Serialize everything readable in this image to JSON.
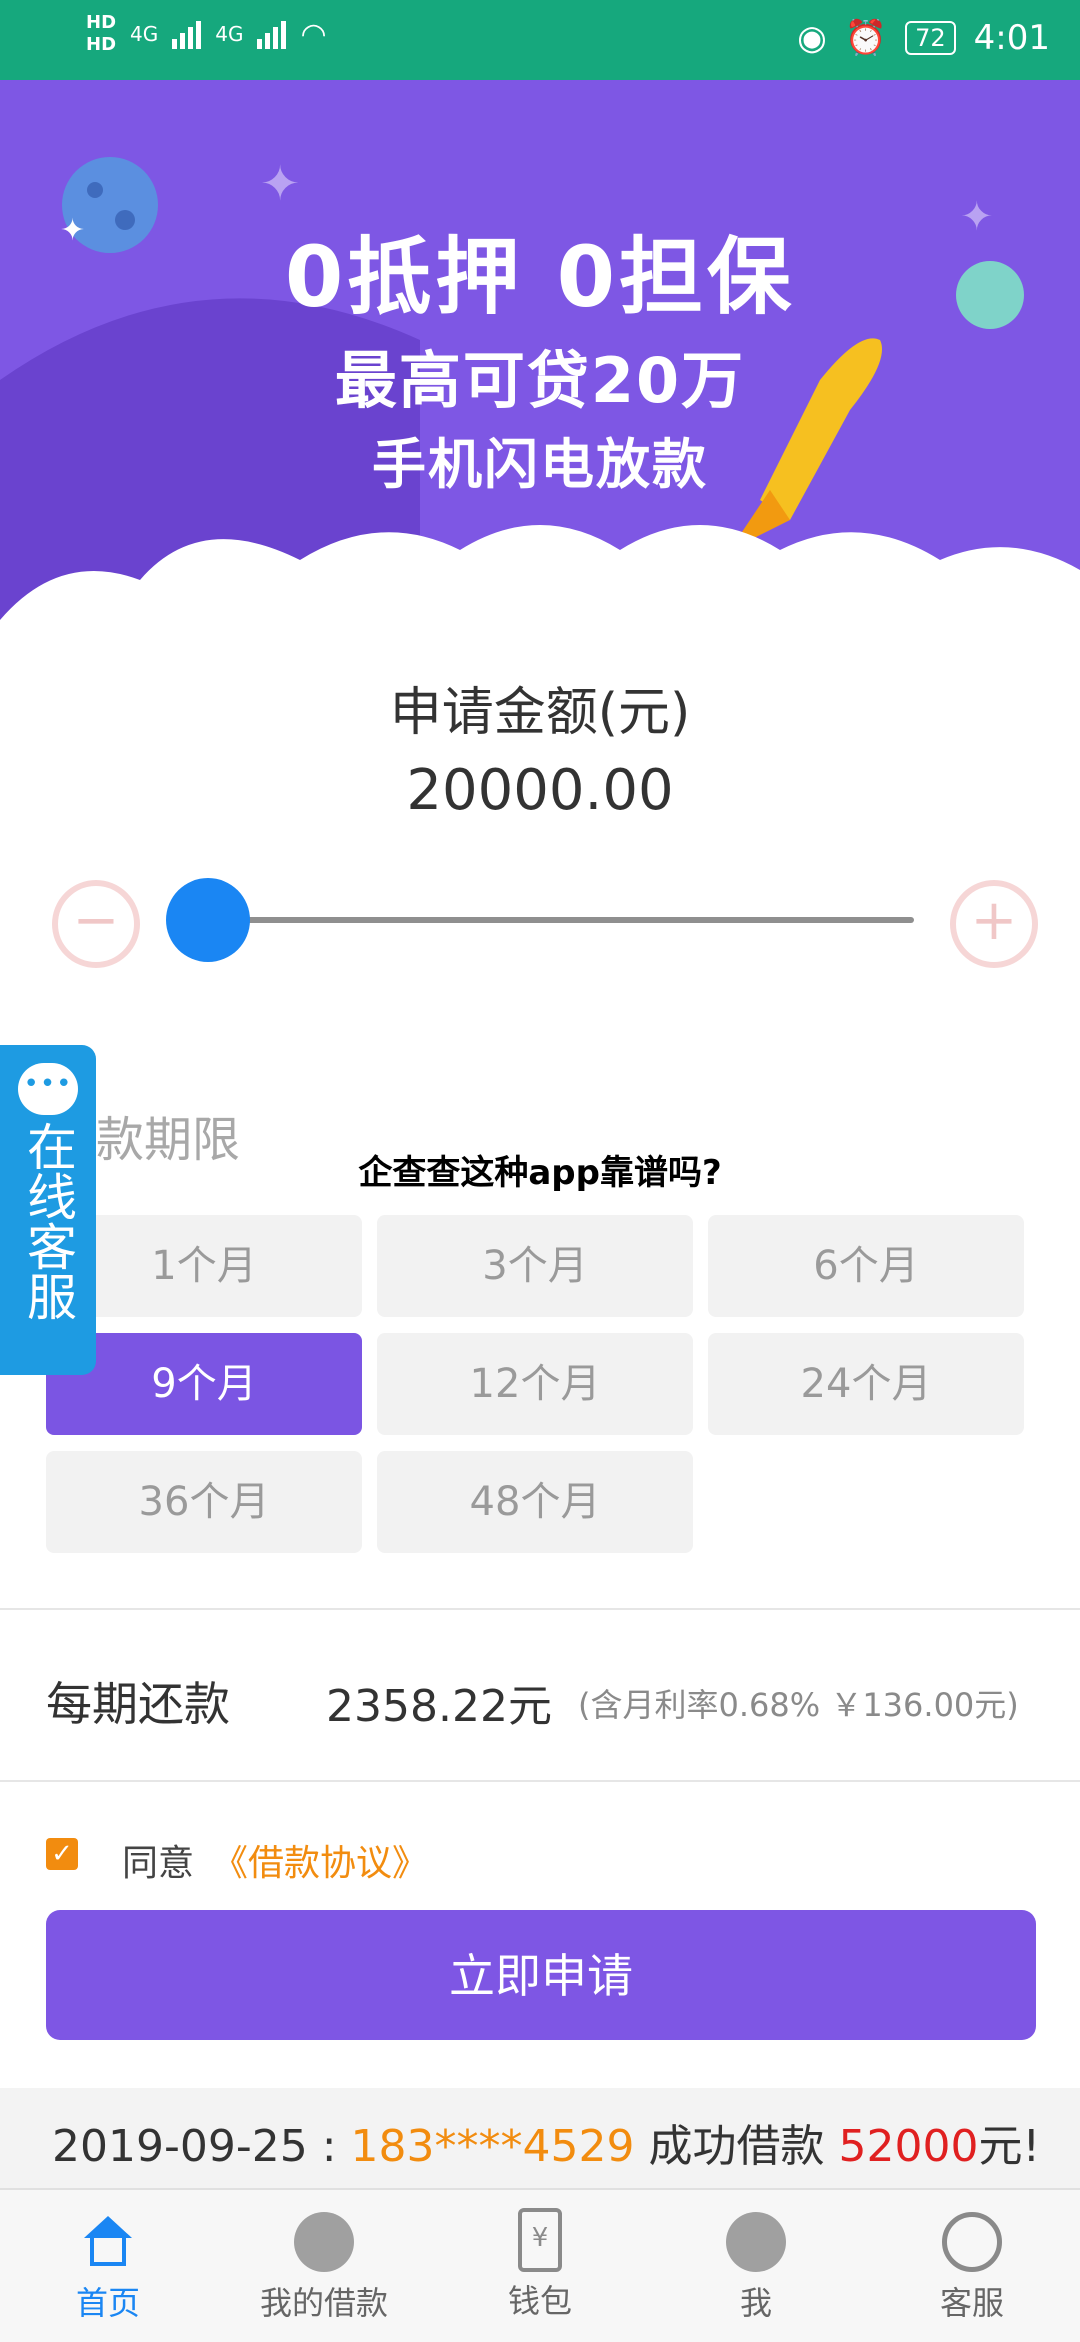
{
  "status_bar": {
    "left": {
      "hd1": "HD",
      "hd2": "HD",
      "net1": "4G",
      "net2": "4G"
    },
    "right": {
      "battery": "72",
      "time": "4:01"
    },
    "icons": [
      "eye-icon",
      "alarm-icon",
      "wifi-icon",
      "signal-icon"
    ]
  },
  "banner": {
    "line1": "0抵押  0担保",
    "line2": "最高可贷20万",
    "line3": "手机闪电放款"
  },
  "loan": {
    "amount_title": "申请金额(元)",
    "amount_value": "20000.00",
    "slider_level": 0.0,
    "minus_label": "−",
    "plus_label": "+"
  },
  "term": {
    "title": "款期限",
    "options": [
      "1个月",
      "3个月",
      "6个月",
      "9个月",
      "12个月",
      "24个月",
      "36个月",
      "48个月"
    ],
    "selected": "9个月"
  },
  "overlay_title": "企查查这种app靠谱吗?",
  "float_service": {
    "label": "在线客服"
  },
  "repayment": {
    "label": "每期还款",
    "value": "2358.22元",
    "note": "(含月利率0.68% ￥136.00元)"
  },
  "agreement": {
    "checkbox_checked": true,
    "agree_text": "同意",
    "link_text": "《借款协议》"
  },
  "apply_button": "立即申请",
  "ticker": {
    "date": "2019-09-25 : ",
    "phone": "183****4529",
    "middle": " 成功借款 ",
    "amount": "52000",
    "suffix": "元!"
  },
  "tabs": [
    {
      "label": "首页",
      "icon": "home-icon",
      "active": true
    },
    {
      "label": "我的借款",
      "icon": "user-icon",
      "active": false
    },
    {
      "label": "钱包",
      "icon": "wallet-icon",
      "active": false
    },
    {
      "label": "我",
      "icon": "user-icon",
      "active": false
    },
    {
      "label": "客服",
      "icon": "headset-icon",
      "active": false
    }
  ],
  "colors": {
    "status_bar": "#16a87d",
    "banner": "#7e57e4",
    "accent": "#7b55e3",
    "blue": "#1a86f3",
    "orange": "#f28c0f",
    "red": "#e02020"
  }
}
